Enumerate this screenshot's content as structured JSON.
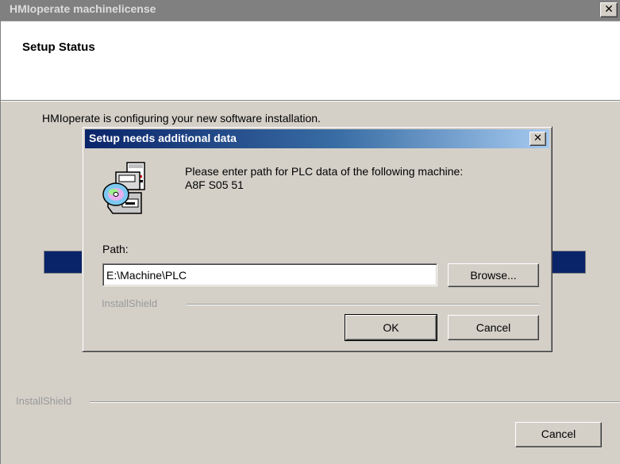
{
  "window": {
    "title": "HMIoperate machinelicense",
    "close_label": "✕"
  },
  "header": {
    "title": "Setup Status"
  },
  "main": {
    "status_text": "HMIoperate is configuring your new software installation.",
    "brand": "InstallShield",
    "cancel_label": "Cancel"
  },
  "dialog": {
    "title": "Setup needs additional data",
    "close_label": "✕",
    "icon": "setup-disk-icon",
    "message_line1": "Please enter path for PLC data of the following machine:",
    "message_line2": "A8F S05 51",
    "path_label": "Path:",
    "path_value": "E:\\Machine\\PLC",
    "browse_label": "Browse...",
    "brand": "InstallShield",
    "ok_label": "OK",
    "cancel_label": "Cancel"
  },
  "colors": {
    "window_bg": "#d4d0c8",
    "inactive_titlebar": "#808080",
    "active_titlebar_start": "#0a246a",
    "active_titlebar_end": "#a6caf0",
    "progress": "#0a246a"
  }
}
